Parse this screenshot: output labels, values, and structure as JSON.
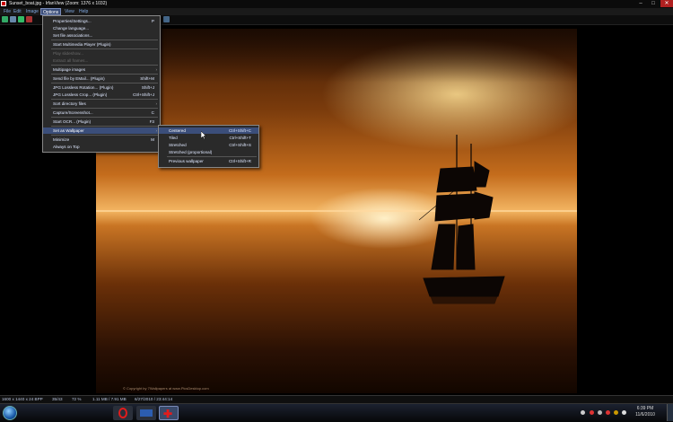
{
  "window": {
    "title": "Sunset_boat.jpg - IrfanView (Zoom: 1376 x 1032)",
    "min_label": "–",
    "max_label": "□",
    "close_label": "✕"
  },
  "menubar": {
    "items": [
      "File",
      "Edit",
      "Image",
      "Options",
      "View",
      "Help"
    ]
  },
  "options_menu": {
    "items": [
      {
        "label": "Properties/Settings...",
        "shortcut": "P",
        "disabled": false
      },
      {
        "label": "Change language...",
        "shortcut": "",
        "disabled": false
      },
      {
        "label": "Set file associations...",
        "shortcut": "",
        "disabled": false
      },
      {
        "label": "Start Multimedia Player (Plugin)",
        "shortcut": "",
        "disabled": false
      },
      {
        "label": "Play slideshow...",
        "shortcut": "",
        "disabled": true
      },
      {
        "label": "Extract all frames...",
        "shortcut": "",
        "disabled": true
      },
      {
        "label": "Multipage images",
        "shortcut": "",
        "arrow": true,
        "disabled": false
      },
      {
        "label": "Send file by EMail... (Plugin)",
        "shortcut": "Shift+M",
        "disabled": false
      },
      {
        "label": "JPG Lossless Rotation... (Plugin)",
        "shortcut": "Shift+J",
        "disabled": false
      },
      {
        "label": "JPG Lossless Crop... (Plugin)",
        "shortcut": "Ctrl+Shift+J",
        "disabled": false
      },
      {
        "label": "Sort directory files",
        "shortcut": "",
        "arrow": true,
        "disabled": false
      },
      {
        "label": "Capture/Screenshot...",
        "shortcut": "C",
        "disabled": false
      },
      {
        "label": "Start OCR... (Plugin)",
        "shortcut": "F3",
        "disabled": false
      },
      {
        "label": "Set as Wallpaper",
        "shortcut": "",
        "arrow": true,
        "disabled": false
      },
      {
        "label": "Minimize",
        "shortcut": "M",
        "disabled": false
      },
      {
        "label": "Always on Top",
        "shortcut": "",
        "disabled": false
      }
    ]
  },
  "wallpaper_menu": {
    "items": [
      {
        "label": "Centered",
        "shortcut": "Ctrl+Shift+C"
      },
      {
        "label": "Tiled",
        "shortcut": "Ctrl+Shift+T"
      },
      {
        "label": "Stretched",
        "shortcut": "Ctrl+Shift+S"
      },
      {
        "label": "Stretched (proportional)",
        "shortcut": ""
      },
      {
        "label": "Previous wallpaper",
        "shortcut": "Ctrl+Shift+R"
      }
    ]
  },
  "photo": {
    "credit": "© Copyright by 7Wallpapers at www.PicsDesktop.com"
  },
  "statusbar": {
    "dimensions": "1600 x 1440 x 24 BPP",
    "index": "35/43",
    "zoom": "72 %",
    "filesize": "1.11 MB / 7.91 MB",
    "datetime": "6/27/2010 / 23:44:14"
  },
  "taskbar": {
    "clock_time": "6:39 PM",
    "clock_date": "11/6/2010"
  },
  "colors": {
    "menu_highlight": "#3b4e7a",
    "menu_text": "#dfe8ff",
    "disabled_text": "#6b6b6b"
  }
}
